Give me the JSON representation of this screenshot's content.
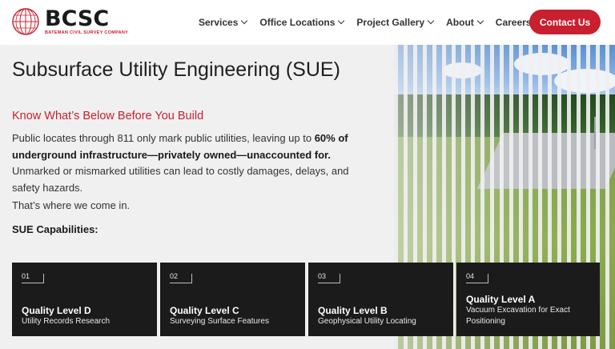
{
  "header": {
    "logo": {
      "word": "BCSC",
      "tagline": "BATEMAN CIVIL SURVEY COMPANY"
    },
    "nav": [
      {
        "label": "Services",
        "dropdown": true
      },
      {
        "label": "Office Locations",
        "dropdown": true
      },
      {
        "label": "Project Gallery",
        "dropdown": true
      },
      {
        "label": "About",
        "dropdown": true
      },
      {
        "label": "Careers",
        "dropdown": false
      }
    ],
    "cta": "Contact Us"
  },
  "hero": {
    "title": "Subsurface Utility Engineering (SUE)",
    "subtitle": "Know What’s Below Before You Build",
    "paragraph_pre": "Public locates through 811 only mark public utilities, leaving up to ",
    "paragraph_bold": "60% of underground infrastructure—privately owned—unaccounted for.",
    "paragraph_post": " Unmarked or mismarked utilities can lead to costly damages, delays, and safety hazards.",
    "paragraph2": "That’s where we come in.",
    "capabilities_heading": "SUE Capabilities:"
  },
  "cards": [
    {
      "num": "01",
      "title": "Quality Level D",
      "desc": "Utility Records Research"
    },
    {
      "num": "02",
      "title": "Quality Level C",
      "desc": "Surveying Surface Features"
    },
    {
      "num": "03",
      "title": "Quality Level B",
      "desc": "Geophysical Utility Locating"
    },
    {
      "num": "04",
      "title": "Quality Level A",
      "desc": "Vacuum Excavation for Exact Positioning"
    }
  ],
  "colors": {
    "brand_red": "#c8202f",
    "card_bg": "#1b1b1b",
    "page_bg": "#f0f0f0"
  }
}
